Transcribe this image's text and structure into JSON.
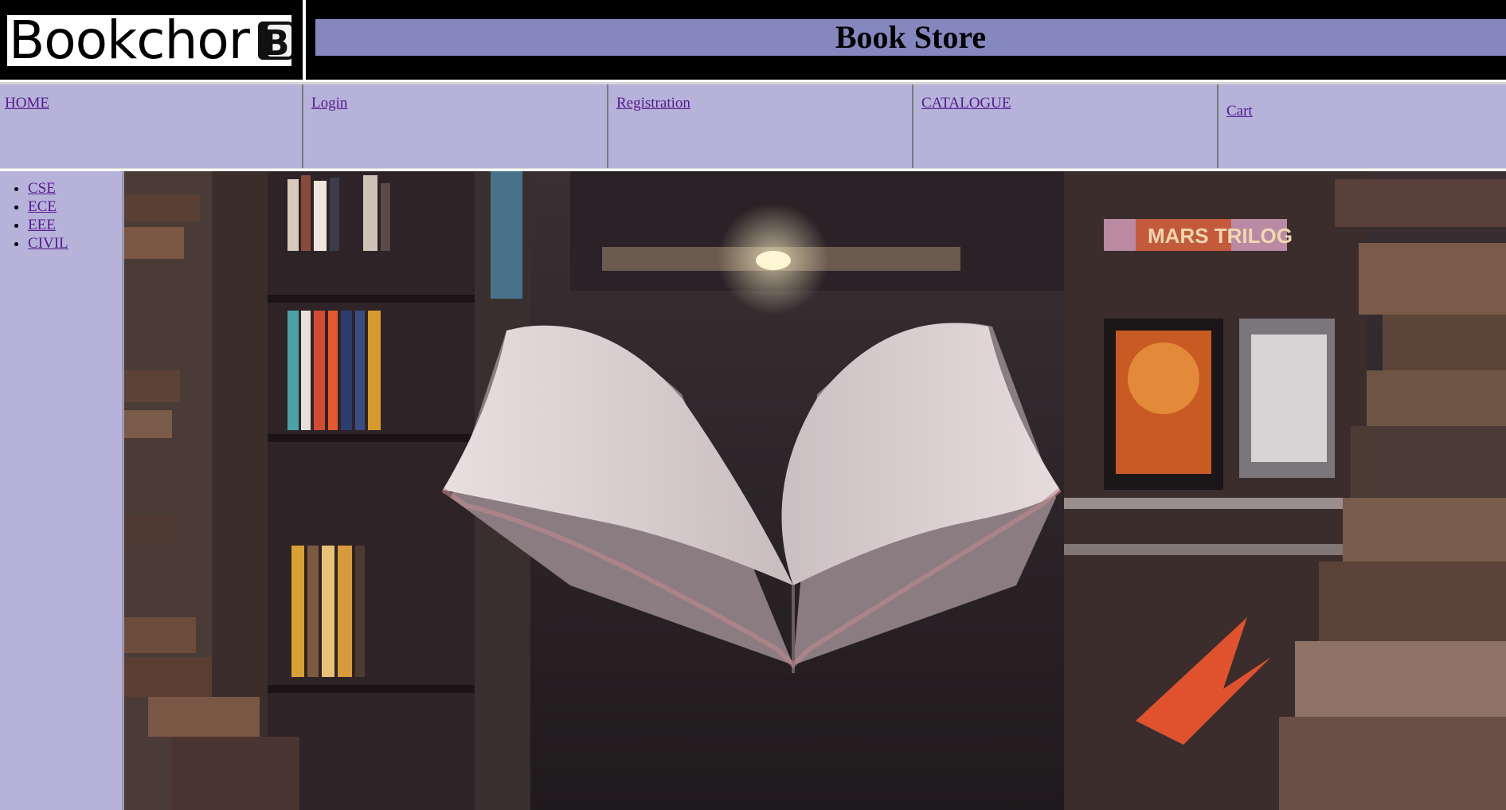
{
  "header": {
    "logo_text": "Bookchor",
    "logo_mark_letter": "B",
    "title": "Book Store",
    "title_bar_color": "#8488be"
  },
  "nav": {
    "items": [
      {
        "label": "HOME"
      },
      {
        "label": "Login"
      },
      {
        "label": "Registration"
      },
      {
        "label": "CATALOGUE"
      },
      {
        "label": "Cart"
      }
    ],
    "background_color": "#b6b2da"
  },
  "sidebar": {
    "categories": [
      {
        "label": "CSE"
      },
      {
        "label": "ECE"
      },
      {
        "label": "EEE"
      },
      {
        "label": "CIVIL"
      }
    ]
  },
  "hero": {
    "image_subject": "open-book-in-bookstore-photo",
    "poster_text": "MARS TRILOG"
  }
}
